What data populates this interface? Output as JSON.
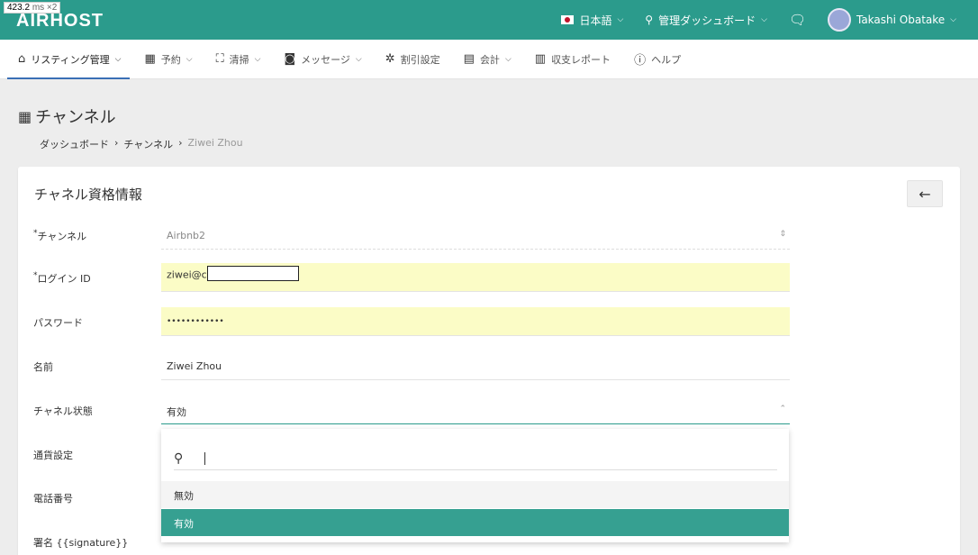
{
  "perf": {
    "value": "423.2",
    "unit": "ms ×2"
  },
  "app": {
    "logo": "AIRHOST"
  },
  "topbar": {
    "language": "日本語",
    "dashboard": "管理ダッシュボード",
    "user": "Takashi Obatake"
  },
  "nav": {
    "items": [
      {
        "label": "リスティング管理",
        "icon": "home-icon"
      },
      {
        "label": "予約",
        "icon": "calendar-icon"
      },
      {
        "label": "清掃",
        "icon": "cleaning-icon"
      },
      {
        "label": "メッセージ",
        "icon": "message-icon"
      },
      {
        "label": "割引設定",
        "icon": "gear-icon"
      },
      {
        "label": "会計",
        "icon": "calculator-icon"
      },
      {
        "label": "収支レポート",
        "icon": "report-icon"
      },
      {
        "label": "ヘルプ",
        "icon": "help-icon"
      }
    ]
  },
  "page": {
    "title": "チャンネル",
    "breadcrumb": [
      "ダッシュボード",
      "チャンネル",
      "Ziwei Zhou"
    ]
  },
  "card": {
    "title": "チャネル資格情報",
    "fields": {
      "channel": {
        "label": "チャンネル",
        "value": "Airbnb2"
      },
      "login": {
        "label": "ログイン ID",
        "value": "ziwei@c"
      },
      "password": {
        "label": "パスワード",
        "value": "••••••••••••"
      },
      "name": {
        "label": "名前",
        "value": "Ziwei Zhou"
      },
      "status": {
        "label": "チャネル状態",
        "value": "有効"
      },
      "currency": {
        "label": "通貨設定"
      },
      "phone": {
        "label": "電話番号"
      },
      "signature": {
        "label": "署名 {{signature}}"
      }
    }
  },
  "dropdown": {
    "search_value": "",
    "options": [
      "無効",
      "有効"
    ],
    "selected": "有効"
  },
  "colors": {
    "brand": "#2b9b8c",
    "selected": "#36a091",
    "autofill": "#fbfcc6"
  }
}
